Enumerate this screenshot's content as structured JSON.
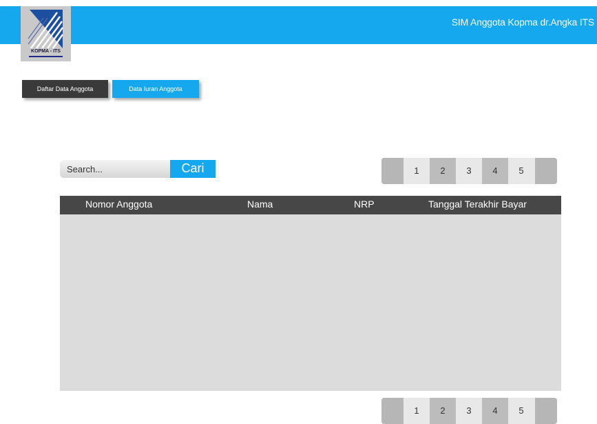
{
  "header": {
    "title": "SIM Anggota Kopma dr.Angka ITS",
    "color": "#16a8ee"
  },
  "logo": {
    "text": "KOPMA - ITS",
    "icon": "kopma-logo-icon"
  },
  "nav": {
    "daftar_label": "Daftar Data Anggota",
    "iuran_label": "Data Iuran Anggota",
    "active": "iuran"
  },
  "search": {
    "placeholder": "Search...",
    "button_label": "Cari"
  },
  "pagination": {
    "pages": [
      "1",
      "2",
      "3",
      "4",
      "5"
    ]
  },
  "table": {
    "columns": [
      "Nomor Anggota",
      "Nama",
      "NRP",
      "Tanggal Terakhir Bayar"
    ],
    "rows": []
  }
}
